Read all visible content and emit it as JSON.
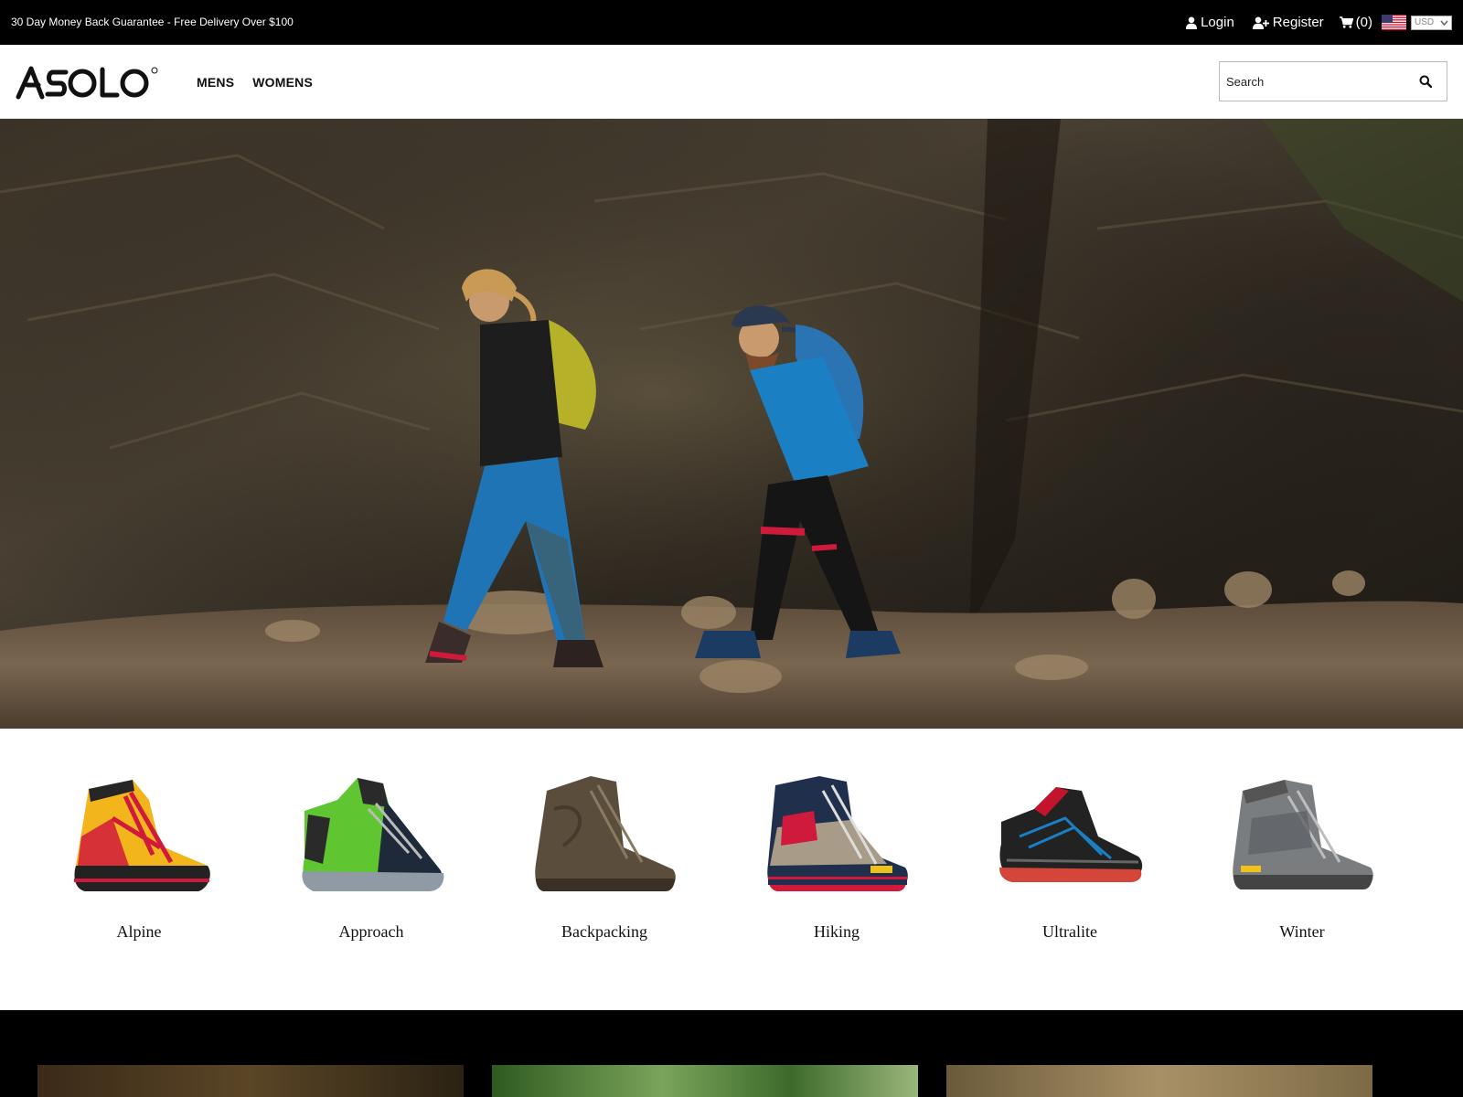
{
  "topbar": {
    "promo": "30 Day Money Back Guarantee - Free Delivery Over $100",
    "login_label": "Login",
    "register_label": "Register",
    "cart_count": "(0)",
    "currency": "USD",
    "login_icon": "user-icon",
    "register_icon": "user-plus-icon",
    "cart_icon": "cart-icon",
    "flag_icon": "us-flag-icon"
  },
  "header": {
    "logo_text": "ASOLO",
    "nav": [
      "MENS",
      "WOMENS"
    ],
    "search_placeholder": "Search",
    "search_icon": "search-icon"
  },
  "categories": [
    {
      "label": "Alpine",
      "color": "#f2b51c"
    },
    {
      "label": "Approach",
      "color": "#5fc531"
    },
    {
      "label": "Backpacking",
      "color": "#5a4d3c"
    },
    {
      "label": "Hiking",
      "color": "#1f2f4c"
    },
    {
      "label": "Ultralite",
      "color": "#222222"
    },
    {
      "label": "Winter",
      "color": "#7a7d80"
    }
  ],
  "colors": {
    "topbar_bg": "#000000",
    "accent_red": "#d01a3c",
    "accent_blue": "#1b7fc4"
  }
}
